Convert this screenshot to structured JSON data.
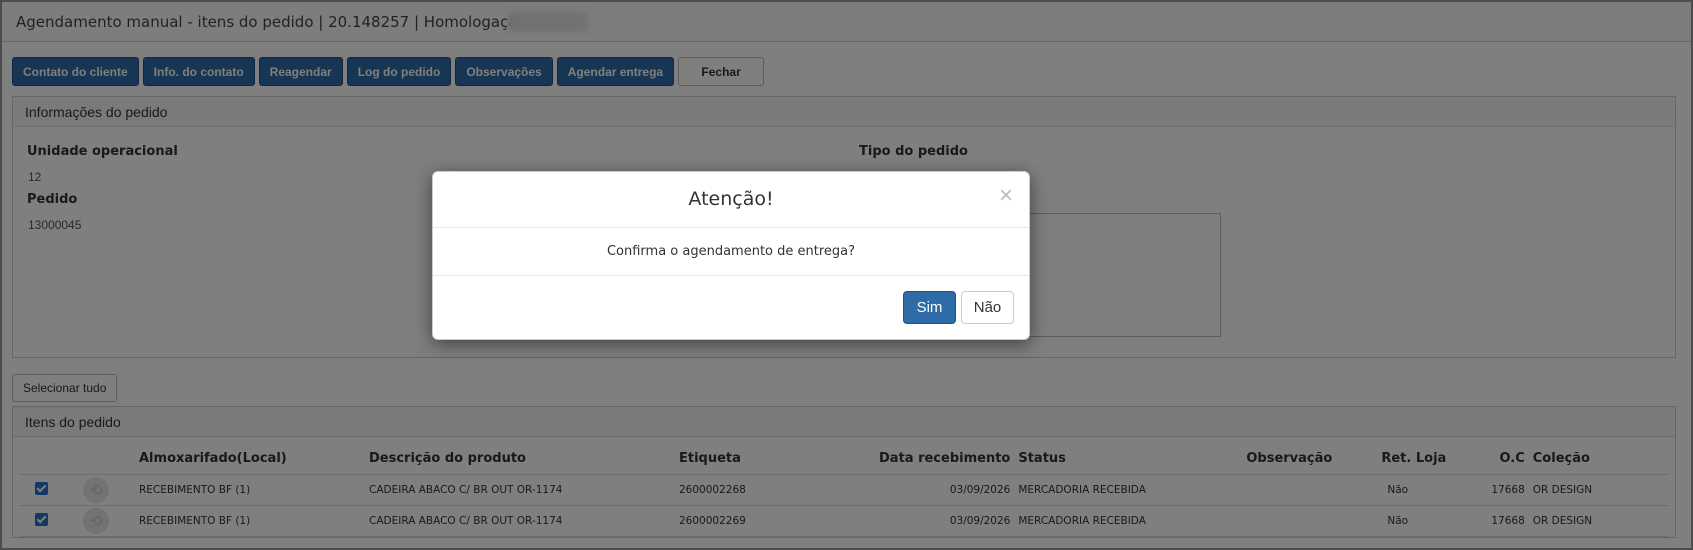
{
  "window": {
    "title": "Agendamento manual - itens do pedido | 20.148257 | Homologação"
  },
  "toolbar": {
    "buttons": [
      "Contato do cliente",
      "Info. do contato",
      "Reagendar",
      "Log do pedido",
      "Observações",
      "Agendar entrega"
    ],
    "close_label": "Fechar"
  },
  "order_info": {
    "heading": "Informações do pedido",
    "unit_label": "Unidade operacional",
    "unit_value": "12",
    "order_label": "Pedido",
    "order_value": "13000045",
    "type_label": "Tipo do pedido"
  },
  "select_all_label": "Selecionar tudo",
  "items": {
    "heading": "Itens do pedido",
    "columns": [
      "Almoxarifado(Local)",
      "Descrição do produto",
      "Etiqueta",
      "Data recebimento",
      "Status",
      "Observação",
      "Ret. Loja",
      "O.C",
      "Coleção"
    ],
    "rows": [
      [
        "RECEBIMENTO BF (1)",
        "CADEIRA ABACO C/ BR OUT OR-1174",
        "2600002268",
        "03/09/2026",
        "MERCADORIA RECEBIDA",
        "",
        "Não",
        "17668",
        "OR DESIGN"
      ],
      [
        "RECEBIMENTO BF (1)",
        "CADEIRA ABACO C/ BR OUT OR-1174",
        "2600002269",
        "03/09/2026",
        "MERCADORIA RECEBIDA",
        "",
        "Não",
        "17668",
        "OR DESIGN"
      ]
    ]
  },
  "modal": {
    "title": "Atenção!",
    "message": "Confirma o agendamento de entrega?",
    "confirm_label": "Sim",
    "cancel_label": "Não",
    "close_glyph": "×"
  },
  "colors": {
    "primary": "#2d6ca6",
    "checkbox": "#2a71d0"
  }
}
